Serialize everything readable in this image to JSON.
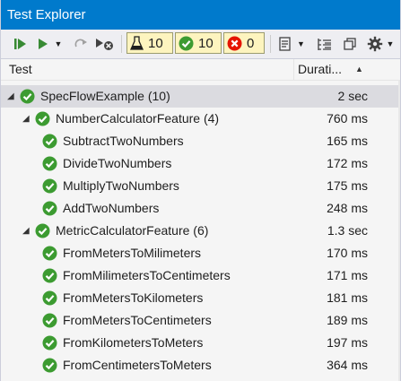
{
  "window": {
    "title": "Test Explorer"
  },
  "toolbar": {
    "counters": [
      {
        "kind": "total",
        "icon": "flask-icon",
        "value": "10"
      },
      {
        "kind": "passed",
        "icon": "passed-check-icon",
        "value": "10",
        "color": "#3c9b31"
      },
      {
        "kind": "failed",
        "icon": "failed-x-icon",
        "value": "0",
        "color": "#e51400"
      }
    ]
  },
  "columns": {
    "test": "Test",
    "duration": "Durati..."
  },
  "colors": {
    "pass": "#3c9b31",
    "titlebar": "#007acc",
    "selection": "#dbdbe0"
  },
  "tree": [
    {
      "level": 0,
      "label": "SpecFlowExample",
      "count": "(10)",
      "duration": "2 sec",
      "expanded": true,
      "selected": true
    },
    {
      "level": 1,
      "label": "NumberCalculatorFeature",
      "count": "(4)",
      "duration": "760 ms",
      "expanded": true
    },
    {
      "level": 2,
      "label": "SubtractTwoNumbers",
      "count": "",
      "duration": "165 ms"
    },
    {
      "level": 2,
      "label": "DivideTwoNumbers",
      "count": "",
      "duration": "172 ms"
    },
    {
      "level": 2,
      "label": "MultiplyTwoNumbers",
      "count": "",
      "duration": "175 ms"
    },
    {
      "level": 2,
      "label": "AddTwoNumbers",
      "count": "",
      "duration": "248 ms"
    },
    {
      "level": 1,
      "label": "MetricCalculatorFeature",
      "count": "(6)",
      "duration": "1.3 sec",
      "expanded": true
    },
    {
      "level": 2,
      "label": "FromMetersToMilimeters",
      "count": "",
      "duration": "170 ms"
    },
    {
      "level": 2,
      "label": "FromMilimetersToCentimeters",
      "count": "",
      "duration": "171 ms"
    },
    {
      "level": 2,
      "label": "FromMetersToKilometers",
      "count": "",
      "duration": "181 ms"
    },
    {
      "level": 2,
      "label": "FromMetersToCentimeters",
      "count": "",
      "duration": "189 ms"
    },
    {
      "level": 2,
      "label": "FromKilometersToMeters",
      "count": "",
      "duration": "197 ms"
    },
    {
      "level": 2,
      "label": "FromCentimetersToMeters",
      "count": "",
      "duration": "364 ms"
    }
  ]
}
